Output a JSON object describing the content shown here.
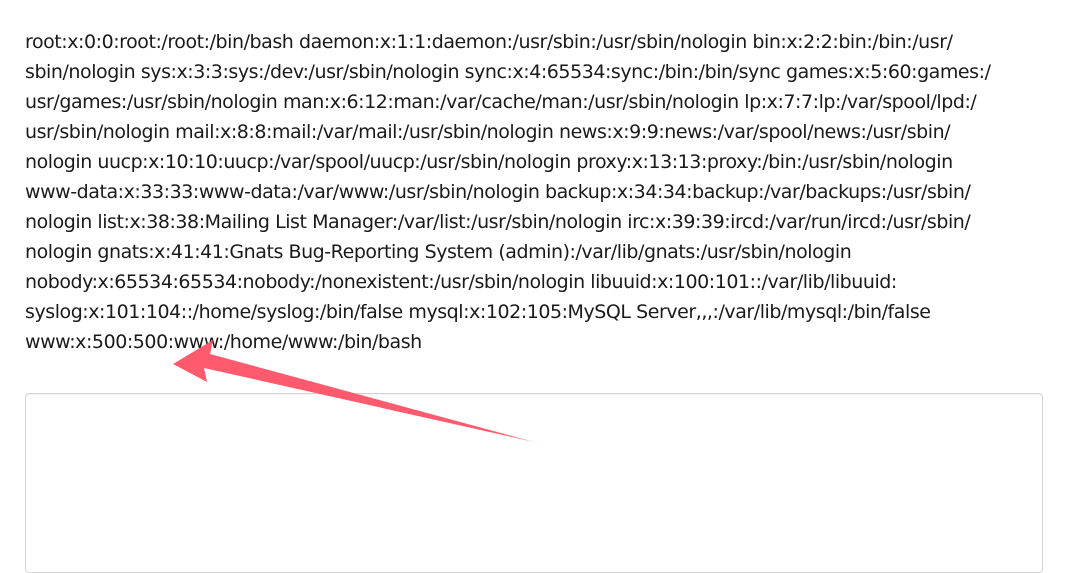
{
  "output": {
    "lines": [
      "root:x:0:0:root:/root:/bin/bash daemon:x:1:1:daemon:/usr/sbin:/usr/sbin/nologin bin:x:2:2:bin:/bin:/usr/",
      "sbin/nologin sys:x:3:3:sys:/dev:/usr/sbin/nologin sync:x:4:65534:sync:/bin:/bin/sync games:x:5:60:games:/",
      "usr/games:/usr/sbin/nologin man:x:6:12:man:/var/cache/man:/usr/sbin/nologin lp:x:7:7:lp:/var/spool/lpd:/",
      "usr/sbin/nologin mail:x:8:8:mail:/var/mail:/usr/sbin/nologin news:x:9:9:news:/var/spool/news:/usr/sbin/",
      "nologin uucp:x:10:10:uucp:/var/spool/uucp:/usr/sbin/nologin proxy:x:13:13:proxy:/bin:/usr/sbin/nologin",
      "www-data:x:33:33:www-data:/var/www:/usr/sbin/nologin backup:x:34:34:backup:/var/backups:/usr/sbin/",
      "nologin list:x:38:38:Mailing List Manager:/var/list:/usr/sbin/nologin irc:x:39:39:ircd:/var/run/ircd:/usr/sbin/",
      "nologin gnats:x:41:41:Gnats Bug-Reporting System (admin):/var/lib/gnats:/usr/sbin/nologin",
      "nobody:x:65534:65534:nobody:/nonexistent:/usr/sbin/nologin libuuid:x:100:101::/var/lib/libuuid:",
      "syslog:x:101:104::/home/syslog:/bin/false mysql:x:102:105:MySQL Server,,,:/var/lib/mysql:/bin/false",
      "www:x:500:500:www:/home/www:/bin/bash"
    ]
  },
  "input_box": {
    "value": "",
    "placeholder": ""
  },
  "annotation": {
    "icon": "arrow-icon",
    "color": "#ff5a6e"
  }
}
